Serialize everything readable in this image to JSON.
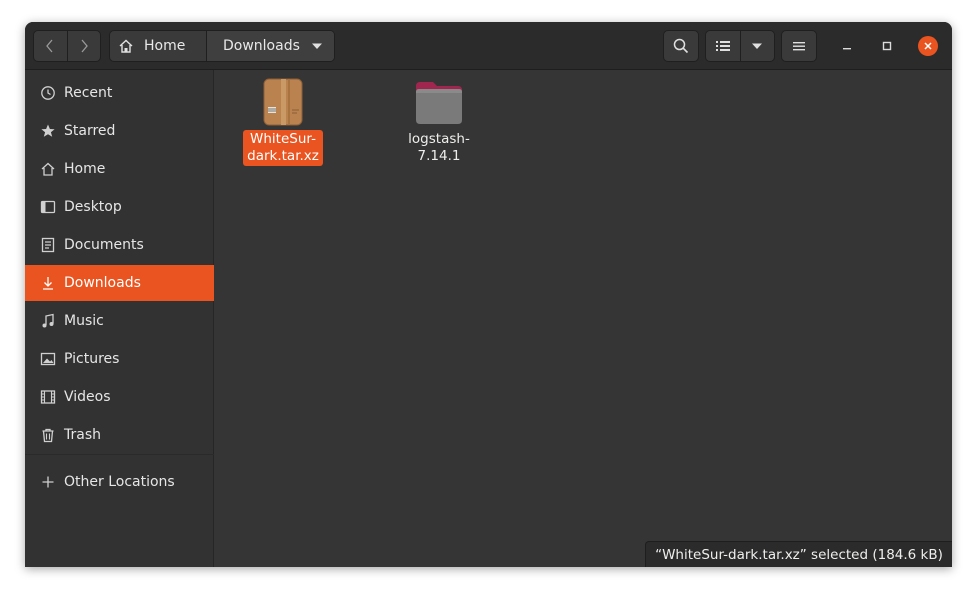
{
  "header": {
    "path": [
      {
        "label": "Home",
        "icon": "home-icon"
      },
      {
        "label": "Downloads",
        "icon": "chevron-down-icon"
      }
    ]
  },
  "sidebar": {
    "items": [
      {
        "label": "Recent",
        "icon": "clock-icon"
      },
      {
        "label": "Starred",
        "icon": "star-icon"
      },
      {
        "label": "Home",
        "icon": "home-icon"
      },
      {
        "label": "Desktop",
        "icon": "desktop-icon"
      },
      {
        "label": "Documents",
        "icon": "document-icon"
      },
      {
        "label": "Downloads",
        "icon": "download-icon",
        "active": true
      },
      {
        "label": "Music",
        "icon": "music-note-icon"
      },
      {
        "label": "Pictures",
        "icon": "picture-icon"
      },
      {
        "label": "Videos",
        "icon": "film-icon"
      },
      {
        "label": "Trash",
        "icon": "trash-icon"
      },
      {
        "label": "Other Locations",
        "icon": "plus-icon"
      }
    ]
  },
  "files": [
    {
      "name": "WhiteSur-\ndark.tar.xz",
      "type": "archive",
      "selected": true
    },
    {
      "name": "logstash-\n7.14.1",
      "type": "folder",
      "selected": false
    }
  ],
  "status": {
    "text": "“WhiteSur-dark.tar.xz” selected  (184.6 kB)"
  },
  "colors": {
    "accent": "#e95420",
    "window_bg": "#353535",
    "headerbar_bg": "#2b2b2b",
    "folder": "#7a7a7a",
    "folder_tab": "#a0254f",
    "archive": "#b9824f"
  }
}
